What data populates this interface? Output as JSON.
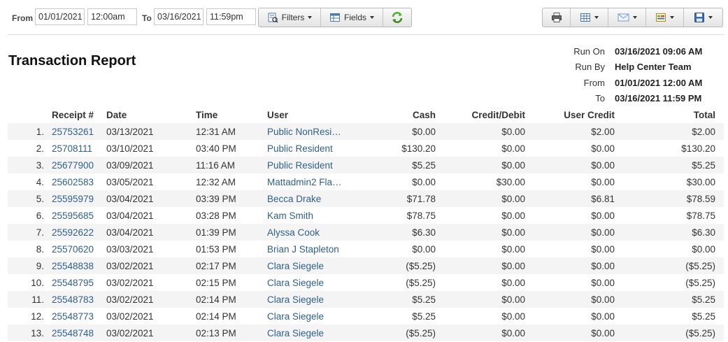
{
  "toolbar": {
    "from_label": "From",
    "from_date": "01/01/2021",
    "from_time": "12:00am",
    "to_label": "To",
    "to_date": "03/16/2021",
    "to_time": "11:59pm",
    "filters_label": "Filters",
    "fields_label": "Fields",
    "icons": [
      "filter-icon",
      "fields-icon",
      "refresh-icon",
      "print-icon",
      "table-icon",
      "email-icon",
      "export-icon",
      "save-icon"
    ]
  },
  "report": {
    "title": "Transaction Report",
    "meta": [
      {
        "key": "Run On",
        "value": "03/16/2021 09:06 AM"
      },
      {
        "key": "Run By",
        "value": "Help Center Team"
      },
      {
        "key": "From",
        "value": "01/01/2021 12:00 AM"
      },
      {
        "key": "To",
        "value": "03/16/2021 11:59 PM"
      }
    ]
  },
  "table": {
    "headers": [
      "",
      "Receipt #",
      "Date",
      "Time",
      "User",
      "Cash",
      "Credit/Debit",
      "User Credit",
      "Total"
    ],
    "rows": [
      [
        "1.",
        "25753261",
        "03/13/2021",
        "12:31 AM",
        "Public NonResi…",
        "$0.00",
        "$0.00",
        "$2.00",
        "$2.00"
      ],
      [
        "2.",
        "25708111",
        "03/10/2021",
        "03:40 PM",
        "Public Resident",
        "$130.20",
        "$0.00",
        "$0.00",
        "$130.20"
      ],
      [
        "3.",
        "25677900",
        "03/09/2021",
        "11:16 AM",
        "Public Resident",
        "$5.25",
        "$0.00",
        "$0.00",
        "$5.25"
      ],
      [
        "4.",
        "25602583",
        "03/05/2021",
        "12:32 AM",
        "Mattadmin2 Fla…",
        "$0.00",
        "$30.00",
        "$0.00",
        "$30.00"
      ],
      [
        "5.",
        "25595979",
        "03/04/2021",
        "03:39 PM",
        "Becca Drake",
        "$71.78",
        "$0.00",
        "$6.81",
        "$78.59"
      ],
      [
        "6.",
        "25595685",
        "03/04/2021",
        "03:28 PM",
        "Kam Smith",
        "$78.75",
        "$0.00",
        "$0.00",
        "$78.75"
      ],
      [
        "7.",
        "25592622",
        "03/04/2021",
        "01:39 PM",
        "Alyssa Cook",
        "$6.30",
        "$0.00",
        "$0.00",
        "$6.30"
      ],
      [
        "8.",
        "25570620",
        "03/03/2021",
        "01:53 PM",
        "Brian J Stapleton",
        "$0.00",
        "$0.00",
        "$0.00",
        "$0.00"
      ],
      [
        "9.",
        "25548838",
        "03/02/2021",
        "02:17 PM",
        "Clara Siegele",
        "($5.25)",
        "$0.00",
        "$0.00",
        "($5.25)"
      ],
      [
        "10.",
        "25548795",
        "03/02/2021",
        "02:15 PM",
        "Clara Siegele",
        "($5.25)",
        "$0.00",
        "$0.00",
        "($5.25)"
      ],
      [
        "11.",
        "25548783",
        "03/02/2021",
        "02:14 PM",
        "Clara Siegele",
        "$5.25",
        "$0.00",
        "$0.00",
        "$5.25"
      ],
      [
        "12.",
        "25548773",
        "03/02/2021",
        "02:14 PM",
        "Clara Siegele",
        "$5.25",
        "$0.00",
        "$0.00",
        "$5.25"
      ],
      [
        "13.",
        "25548748",
        "03/02/2021",
        "02:13 PM",
        "Clara Siegele",
        "($5.25)",
        "$0.00",
        "$0.00",
        "($5.25)"
      ]
    ]
  },
  "colors": {
    "link": "#2f5f8f",
    "stripe": "#f4f4f4",
    "refresh_green": "#4caf2a"
  }
}
